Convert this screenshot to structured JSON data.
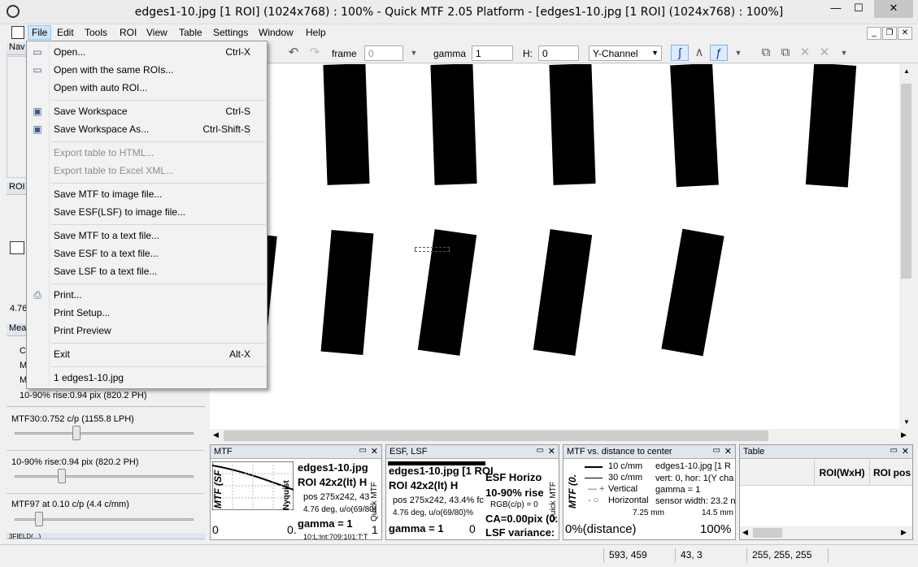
{
  "window": {
    "title": "edges1-10.jpg [1 ROI] (1024x768) : 100% - Quick MTF 2.05 Platform - [edges1-10.jpg [1 ROI] (1024x768) : 100%]",
    "minimize": "—",
    "maximize": "☐",
    "close": "✕"
  },
  "menubar": {
    "items": [
      "File",
      "Edit",
      "Tools",
      "ROI",
      "View",
      "Table",
      "Settings",
      "Window",
      "Help"
    ]
  },
  "mdi_buttons": {
    "minimize": "_",
    "restore": "❐",
    "close": "✕"
  },
  "toolbar": {
    "frame_label": "frame",
    "frame_value": "0",
    "gamma_label": "gamma",
    "gamma_value": "1",
    "h_label": "H:",
    "h_value": "0",
    "channel": "Y-Channel"
  },
  "sidebar": {
    "nav_head": "Nav",
    "roi_head": "ROI",
    "roi_value": "4.76",
    "meas_head": "Mea",
    "meas_lines": [
      "C",
      "M",
      "M"
    ],
    "rise_line": "10-90% rise:0.94 pix (820.2 PH)",
    "sliders": [
      {
        "label": "MTF30:0.752 c/p (1155.8 LPH)",
        "level": 0.34
      },
      {
        "label": "10-90% rise:0.94 pix (820.2 PH)",
        "level": 0.25
      },
      {
        "label": "MTF97 at 0.10 c/p (4.4 c/mm)",
        "level": 0.12
      }
    ],
    "bottom_head": "3FIELD(...)"
  },
  "file_menu": {
    "items": [
      {
        "label": "Open...",
        "shortcut": "Ctrl-X",
        "icon": "open-folder-icon",
        "disabled": false
      },
      {
        "label": "Open with the same ROIs...",
        "shortcut": "",
        "icon": "open-folder-icon",
        "disabled": false
      },
      {
        "label": "Open with auto ROI...",
        "shortcut": "",
        "icon": "",
        "disabled": false
      },
      {
        "label": "Save Workspace",
        "shortcut": "Ctrl-S",
        "icon": "save-disk-icon",
        "disabled": false
      },
      {
        "label": "Save Workspace As...",
        "shortcut": "Ctrl-Shift-S",
        "icon": "save-as-icon",
        "disabled": false
      },
      {
        "label": "Export table to HTML...",
        "shortcut": "",
        "icon": "",
        "disabled": true
      },
      {
        "label": "Export table to Excel XML...",
        "shortcut": "",
        "icon": "",
        "disabled": true
      },
      {
        "label": "Save MTF to image file...",
        "shortcut": "",
        "icon": "",
        "disabled": false
      },
      {
        "label": "Save ESF(LSF) to image file...",
        "shortcut": "",
        "icon": "",
        "disabled": false
      },
      {
        "label": "Save MTF to a text file...",
        "shortcut": "",
        "icon": "",
        "disabled": false
      },
      {
        "label": "Save ESF to a text file...",
        "shortcut": "",
        "icon": "",
        "disabled": false
      },
      {
        "label": "Save LSF to a text file...",
        "shortcut": "",
        "icon": "",
        "disabled": false
      },
      {
        "label": "Print...",
        "shortcut": "",
        "icon": "printer-icon",
        "disabled": false
      },
      {
        "label": "Print Setup...",
        "shortcut": "",
        "icon": "",
        "disabled": false
      },
      {
        "label": "Print Preview",
        "shortcut": "",
        "icon": "",
        "disabled": false
      },
      {
        "label": "Exit",
        "shortcut": "Alt-X",
        "icon": "",
        "disabled": false
      },
      {
        "label": "1 edges1-10.jpg",
        "shortcut": "",
        "icon": "",
        "disabled": false
      }
    ]
  },
  "panels": {
    "mtf": {
      "title": "MTF",
      "axis_label": "MTF (SF",
      "nyquist": "Nyquist",
      "file": "edges1-10.jpg",
      "roi": "ROI 42x2(lt) H",
      "pos": "pos 275x242, 43",
      "angle": "4.76 deg, u/o(69/80)",
      "gamma": "gamma = 1",
      "left_val": "0",
      "mid_val": "0.",
      "right_val": "1",
      "side_label": "Quick MTF",
      "footer": "10:L:lnt:709:101:T:T"
    },
    "esf": {
      "title": "ESF, LSF",
      "file": "edges1-10.jpg [1 ROI",
      "roi": "ROI 42x2(lt) H",
      "pos": "pos 275x242, 43.4% fc",
      "angle": "4.76 deg, u/o(69/80)%",
      "heading": "ESF Horizo",
      "rise": "10-90% rise",
      "rgb": "RGB(c/p) = 0",
      "ca": "CA=0.00pix (0.",
      "lsf": "LSF variance:",
      "gamma": "gamma = 1",
      "zero": "0",
      "side_label": "Quick MTF"
    },
    "dist": {
      "title": "MTF vs. distance to center",
      "axis_label": "MTF (0.",
      "legend": [
        "10 c/mm",
        "30 c/mm",
        "Vertical",
        "Horizontal"
      ],
      "file": "edges1-10.jpg [1 R",
      "vert": "vert: 0, hor: 1(Y cha",
      "gamma": "gamma = 1",
      "sensor": "sensor width: 23.2 n",
      "tick1": "7.25 mm",
      "tick2": "14.5 mm",
      "bottom_left": "0%(distance)",
      "bottom_right": "100%"
    },
    "table": {
      "title": "Table",
      "headers": [
        "ROI(WxH)",
        "ROI pos"
      ]
    }
  },
  "status": {
    "pos": "593, 459",
    "size": "43, 3",
    "rgb": "255, 255, 255"
  }
}
